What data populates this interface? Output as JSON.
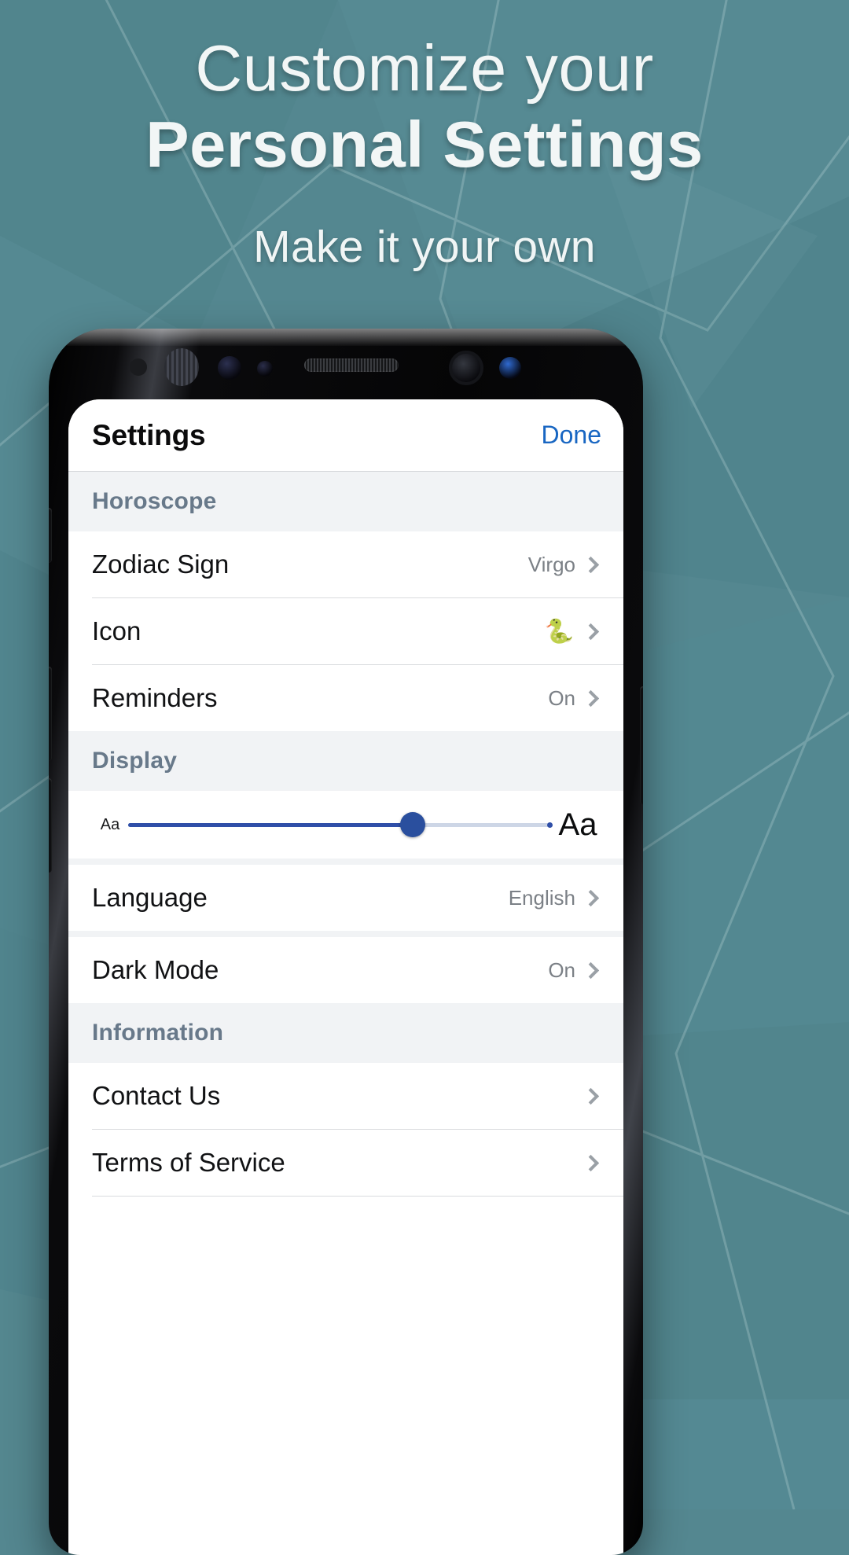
{
  "hero": {
    "line1": "Customize your",
    "line2": "Personal Settings",
    "subtitle": "Make it your own"
  },
  "theme": {
    "background": "#548790",
    "accent": "#1866c2",
    "slider_fill": "#2f4fa8",
    "section_header_text": "#68798a"
  },
  "phone_screen": {
    "nav": {
      "title": "Settings",
      "done_label": "Done"
    },
    "sections": [
      {
        "header": "Horoscope",
        "rows": [
          {
            "label": "Zodiac Sign",
            "value": "Virgo",
            "accessory": "chevron-right-icon"
          },
          {
            "label": "Icon",
            "value": "🐍",
            "accessory": "chevron-right-icon"
          },
          {
            "label": "Reminders",
            "value": "On",
            "accessory": "chevron-right-icon"
          }
        ]
      },
      {
        "header": "Display",
        "slider": {
          "min_label": "Aa",
          "max_label": "Aa",
          "value_percent": 67
        },
        "rows": [
          {
            "label": "Language",
            "value": "English",
            "accessory": "chevron-right-icon"
          },
          {
            "label": "Dark Mode",
            "value": "On",
            "accessory": "chevron-right-icon"
          }
        ]
      },
      {
        "header": "Information",
        "rows": [
          {
            "label": "Contact Us",
            "value": "",
            "accessory": "chevron-right-icon"
          },
          {
            "label": "Terms of Service",
            "value": "",
            "accessory": "chevron-right-icon"
          }
        ]
      }
    ]
  }
}
